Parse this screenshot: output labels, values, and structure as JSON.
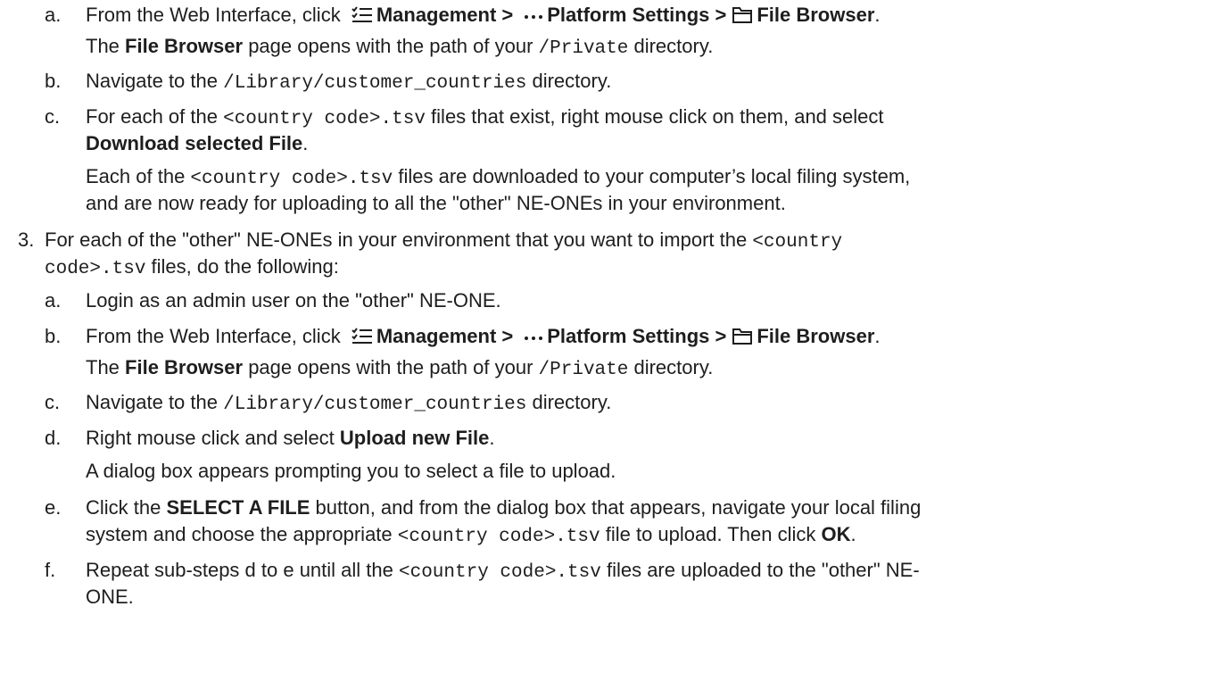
{
  "nav": {
    "web_interface": "From the Web Interface, click ",
    "management": "Management >",
    "platform_settings": "Platform Settings >",
    "file_browser": "File Browser",
    "period": "."
  },
  "icons": {
    "management": "list-checks-icon",
    "platform_settings": "ellipsis-icon",
    "file_browser": "folder-icon"
  },
  "step2": {
    "a": {
      "marker": "a.",
      "note_pre": "The ",
      "note_bold": "File Browser",
      "note_mid": " page opens with the path of your ",
      "note_code": "/Private",
      "note_post": " directory."
    },
    "b": {
      "marker": "b.",
      "pre": "Navigate to the ",
      "code": "/Library/customer_countries",
      "post": " directory."
    },
    "c": {
      "marker": "c.",
      "pre": "For each of the ",
      "code": "<country code>.tsv",
      "post": " files that exist, right mouse click on them, and select",
      "bold": "Download selected File",
      "bold_post": ".",
      "note_code": "<country code>.tsv",
      "note_pre": "Each of the ",
      "note_post": " files are downloaded to your computer’s local filing system,",
      "note2": "and are now ready for uploading to all the \"other\" NE-ONEs in your environment."
    }
  },
  "step3": {
    "marker": "3.",
    "pre": "For each of the \"other\" NE-ONEs in your environment that you want to import the ",
    "code1": "<country",
    "code2": "code>.tsv",
    "post": " files, do the following:",
    "a": {
      "marker": "a.",
      "text": "Login as an admin user on the \"other\" NE-ONE."
    },
    "b": {
      "marker": "b.",
      "note_pre": "The ",
      "note_bold": "File Browser",
      "note_mid": " page opens with the path of your ",
      "note_code": "/Private",
      "note_post": " directory."
    },
    "c": {
      "marker": "c.",
      "pre": "Navigate to the ",
      "code": "/Library/customer_countries",
      "post": " directory."
    },
    "d": {
      "marker": "d.",
      "pre": "Right mouse click and select ",
      "bold": "Upload new File",
      "post": ".",
      "note": "A dialog box appears prompting you to select a file to upload."
    },
    "e": {
      "marker": "e.",
      "pre": "Click the ",
      "bold": "SELECT A FILE",
      "post": " button, and from the dialog box that appears, navigate your local filing",
      "l2_pre": "system and choose the appropriate ",
      "l2_code": "<country code>.tsv",
      "l2_mid": " file to upload. Then click ",
      "l2_bold": "OK",
      "l2_post": "."
    },
    "f": {
      "marker": "f.",
      "pre": "Repeat sub-steps d to e until all the ",
      "code": "<country code>.tsv",
      "post": " files are uploaded to the \"other\" NE-",
      "l2": "ONE."
    }
  }
}
